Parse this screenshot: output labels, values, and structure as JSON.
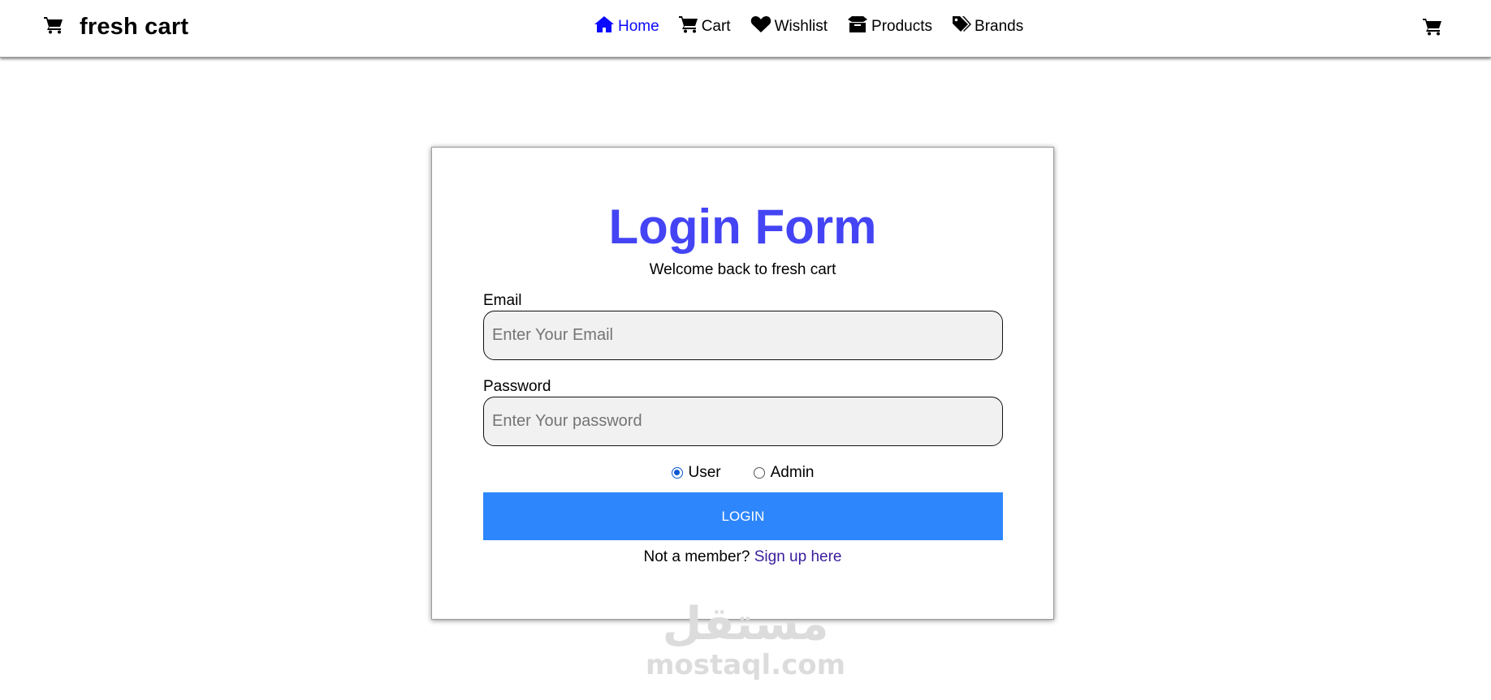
{
  "nav": {
    "brand": "fresh cart",
    "links": [
      {
        "label": "Home",
        "icon": "home-icon",
        "active": true
      },
      {
        "label": "Cart",
        "icon": "cart-icon",
        "active": false
      },
      {
        "label": "Wishlist",
        "icon": "heart-icon",
        "active": false
      },
      {
        "label": "Products",
        "icon": "box-icon",
        "active": false
      },
      {
        "label": "Brands",
        "icon": "tags-icon",
        "active": false
      }
    ],
    "active_color": "#0a0aff"
  },
  "form": {
    "title": "Login Form",
    "subtitle": "Welcome back to fresh cart",
    "email_label": "Email",
    "email_placeholder": "Enter Your Email",
    "password_label": "Password",
    "password_placeholder": "Enter Your password",
    "roles": [
      {
        "label": "User",
        "checked": true
      },
      {
        "label": "Admin",
        "checked": false
      }
    ],
    "login_label": "LOGIN",
    "signup_prompt": "Not a member?",
    "signup_link": "Sign up here",
    "title_color": "#4444f5",
    "button_color": "#2e86fc"
  },
  "watermark": {
    "arabic": "مستقل",
    "latin": "mostaql.com"
  }
}
